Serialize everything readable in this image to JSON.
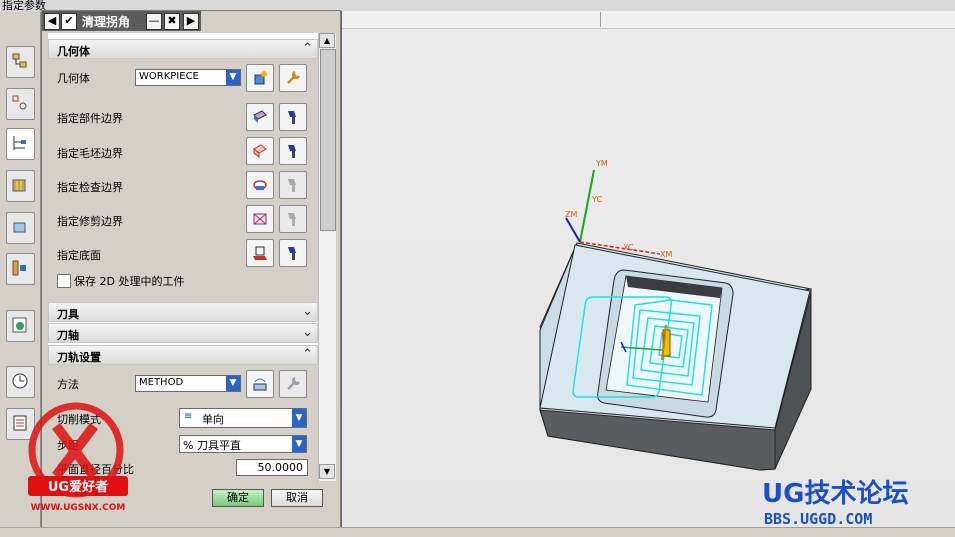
{
  "header": {
    "partial_title": "指定参数"
  },
  "dialog": {
    "title": "清理拐角",
    "geometry": {
      "title": "几何体",
      "geometry_label": "几何体",
      "geometry_value": "WORKPIECE",
      "rows": [
        {
          "label": "指定部件边界",
          "icon": "part-boundary-icon"
        },
        {
          "label": "指定毛坯边界",
          "icon": "blank-boundary-icon"
        },
        {
          "label": "指定检查边界",
          "icon": "check-boundary-icon"
        },
        {
          "label": "指定修剪边界",
          "icon": "trim-boundary-icon"
        },
        {
          "label": "指定底面",
          "icon": "floor-plane-icon"
        }
      ],
      "save_2d_label": "保存 2D 处理中的工件"
    },
    "sections": {
      "tool": "刀具",
      "tool_axis": "刀轴",
      "path_settings": "刀轨设置"
    },
    "path": {
      "method_label": "方法",
      "method_value": "METHOD",
      "cut_pattern_label": "切削模式",
      "cut_pattern_value": "单向",
      "stepover_label": "步距",
      "stepover_value": "% 刀具平直",
      "flat_diameter_label": "平面直径百分比",
      "flat_diameter_value": "50.0000"
    },
    "ok_label": "确定",
    "cancel_label": "取消"
  },
  "viewport": {
    "axis_labels": {
      "ym": "YM",
      "yc": "YC",
      "zm": "ZM",
      "xc": "XC",
      "xm": "XM"
    }
  },
  "watermarks": {
    "left_badge": "UG爱好者",
    "left_url": "WWW.UGSNX.COM",
    "right_brand": "UG技术论坛",
    "right_url": "BBS.UGGD.COM"
  },
  "colors": {
    "toolpath": "#19e0e8",
    "block_top": "#d5e6ec",
    "ok_button": "#79c879",
    "dropdown": "#2b64c8"
  }
}
